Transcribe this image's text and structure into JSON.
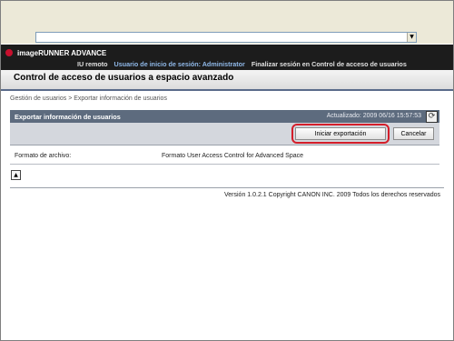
{
  "browser": {
    "address_dropdown_icon": "chevron-down-icon"
  },
  "header": {
    "brand": "imageRUNNER ADVANCE",
    "nav": {
      "remote_ui": "IU remoto",
      "login_user": "Usuario de inicio de sesión: Administrator",
      "logout": "Finalizar sesión en Control de acceso de usuarios"
    }
  },
  "page": {
    "title": "Control de acceso de usuarios a espacio avanzado",
    "breadcrumb": "Gestión de usuarios > Exportar información de usuarios"
  },
  "section": {
    "title": "Exportar información de usuarios",
    "updated": "Actualizado: 2009 06/16 15:57:53",
    "refresh_icon": "refresh-icon"
  },
  "actions": {
    "export_label": "Iniciar exportación",
    "cancel_label": "Cancelar",
    "highlight_color": "#d41e2a"
  },
  "format": {
    "label": "Formato de archivo:",
    "value": "Formato User Access Control for Advanced Space"
  },
  "footer": {
    "copyright": "Versión 1.0.2.1 Copyright CANON INC. 2009 Todos los derechos reservados"
  },
  "colors": {
    "brand_bar": "#1c1c1c",
    "section_header": "#5d6b7e",
    "brand_red": "#c8102e"
  }
}
